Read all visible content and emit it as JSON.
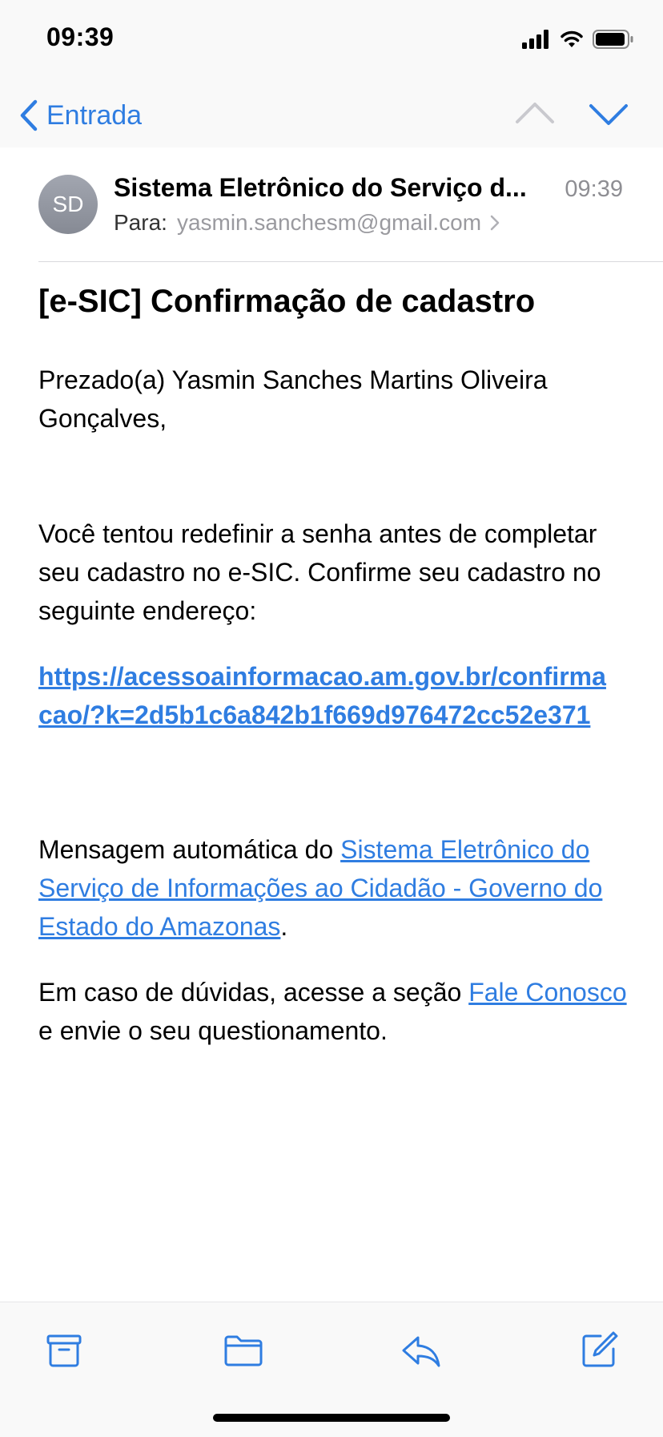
{
  "status": {
    "time": "09:39"
  },
  "nav": {
    "back_label": "Entrada"
  },
  "header": {
    "avatar_initials": "SD",
    "sender": "Sistema Eletrônico do Serviço d...",
    "time": "09:39",
    "to_label": "Para:",
    "to_address": "yasmin.sanchesm@gmail.com"
  },
  "message": {
    "subject": "[e-SIC] Confirmação de cadastro",
    "greeting": "Prezado(a) Yasmin Sanches Martins Oliveira Gonçalves,",
    "paragraph": "Você tentou redefinir a senha antes de completar seu cadastro no e-SIC. Confirme seu cadastro no seguinte endereço:",
    "confirm_link": "https://acessoainformacao.am.gov.br/confirmacao/?k=2d5b1c6a842b1f669d976472cc52e371",
    "auto_prefix": "Mensagem automática do ",
    "auto_link": "Sistema Eletrônico do Serviço de Informações ao Cidadão - Governo do Estado do Amazonas",
    "auto_suffix": ".",
    "help_prefix": "Em caso de dúvidas, acesse a seção ",
    "help_link": "Fale Conosco",
    "help_suffix": " e envie o seu questionamento."
  },
  "colors": {
    "accent": "#2f7de1",
    "secondary_text": "#8e8e93"
  },
  "toolbar": {
    "icons": [
      "archive-icon",
      "folder-icon",
      "reply-icon",
      "compose-icon"
    ]
  }
}
